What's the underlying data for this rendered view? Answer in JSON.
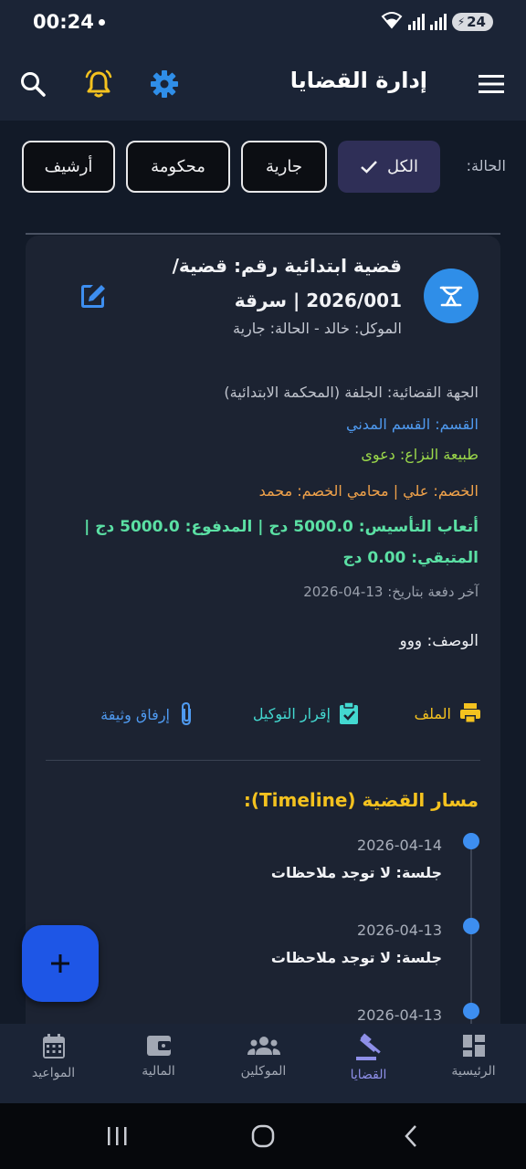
{
  "status_bar": {
    "time": "00:24",
    "battery": "24"
  },
  "app_bar": {
    "title": "إدارة القضايا"
  },
  "filter": {
    "label": "الحالة:",
    "chips": [
      "الكل",
      "جارية",
      "محكومة",
      "أرشيف"
    ],
    "selected": "الكل"
  },
  "case": {
    "title": "قضية ابتدائية رقم: قضية/ 2026/001 | سرقة",
    "subtitle": "الموكل: خالد - الحالة: جارية",
    "court": "الجهة القضائية: الجلفة (المحكمة الابتدائية)",
    "department": "القسم: القسم المدني",
    "dispute": "طبيعة النزاع: دعوى",
    "opponent": "الخصم: علي | محامي الخصم: محمد",
    "fees": "أتعاب التأسيس: 5000.0 دج | المدفوع: 5000.0 دج | المتبقي: 0.00 دج",
    "last_payment": "آخر دفعة بتاريخ: 13-04-2026",
    "description": "الوصف: ووو",
    "actions": {
      "file": "الملف",
      "proxy": "إقرار التوكيل",
      "attach": "إرفاق وثيقة"
    },
    "colors": {
      "department": "#4f9af0",
      "dispute": "#9bd84a",
      "opponent": "#f0a24a",
      "fees": "#5be0a4",
      "timeline_title": "#f4c21f"
    }
  },
  "timeline": {
    "title": "مسار القضية (Timeline):",
    "entries": [
      {
        "date": "2026-04-14",
        "text": "جلسة: لا توجد ملاحظات"
      },
      {
        "date": "2026-04-13",
        "text": "جلسة: لا توجد ملاحظات"
      },
      {
        "date": "2026-04-13",
        "text": ""
      }
    ]
  },
  "fab": {
    "icon": "plus-icon"
  },
  "bottom_nav": {
    "items": [
      "الرئيسية",
      "القضايا",
      "الموكلين",
      "المالية",
      "المواعيد"
    ],
    "active": "القضايا"
  }
}
